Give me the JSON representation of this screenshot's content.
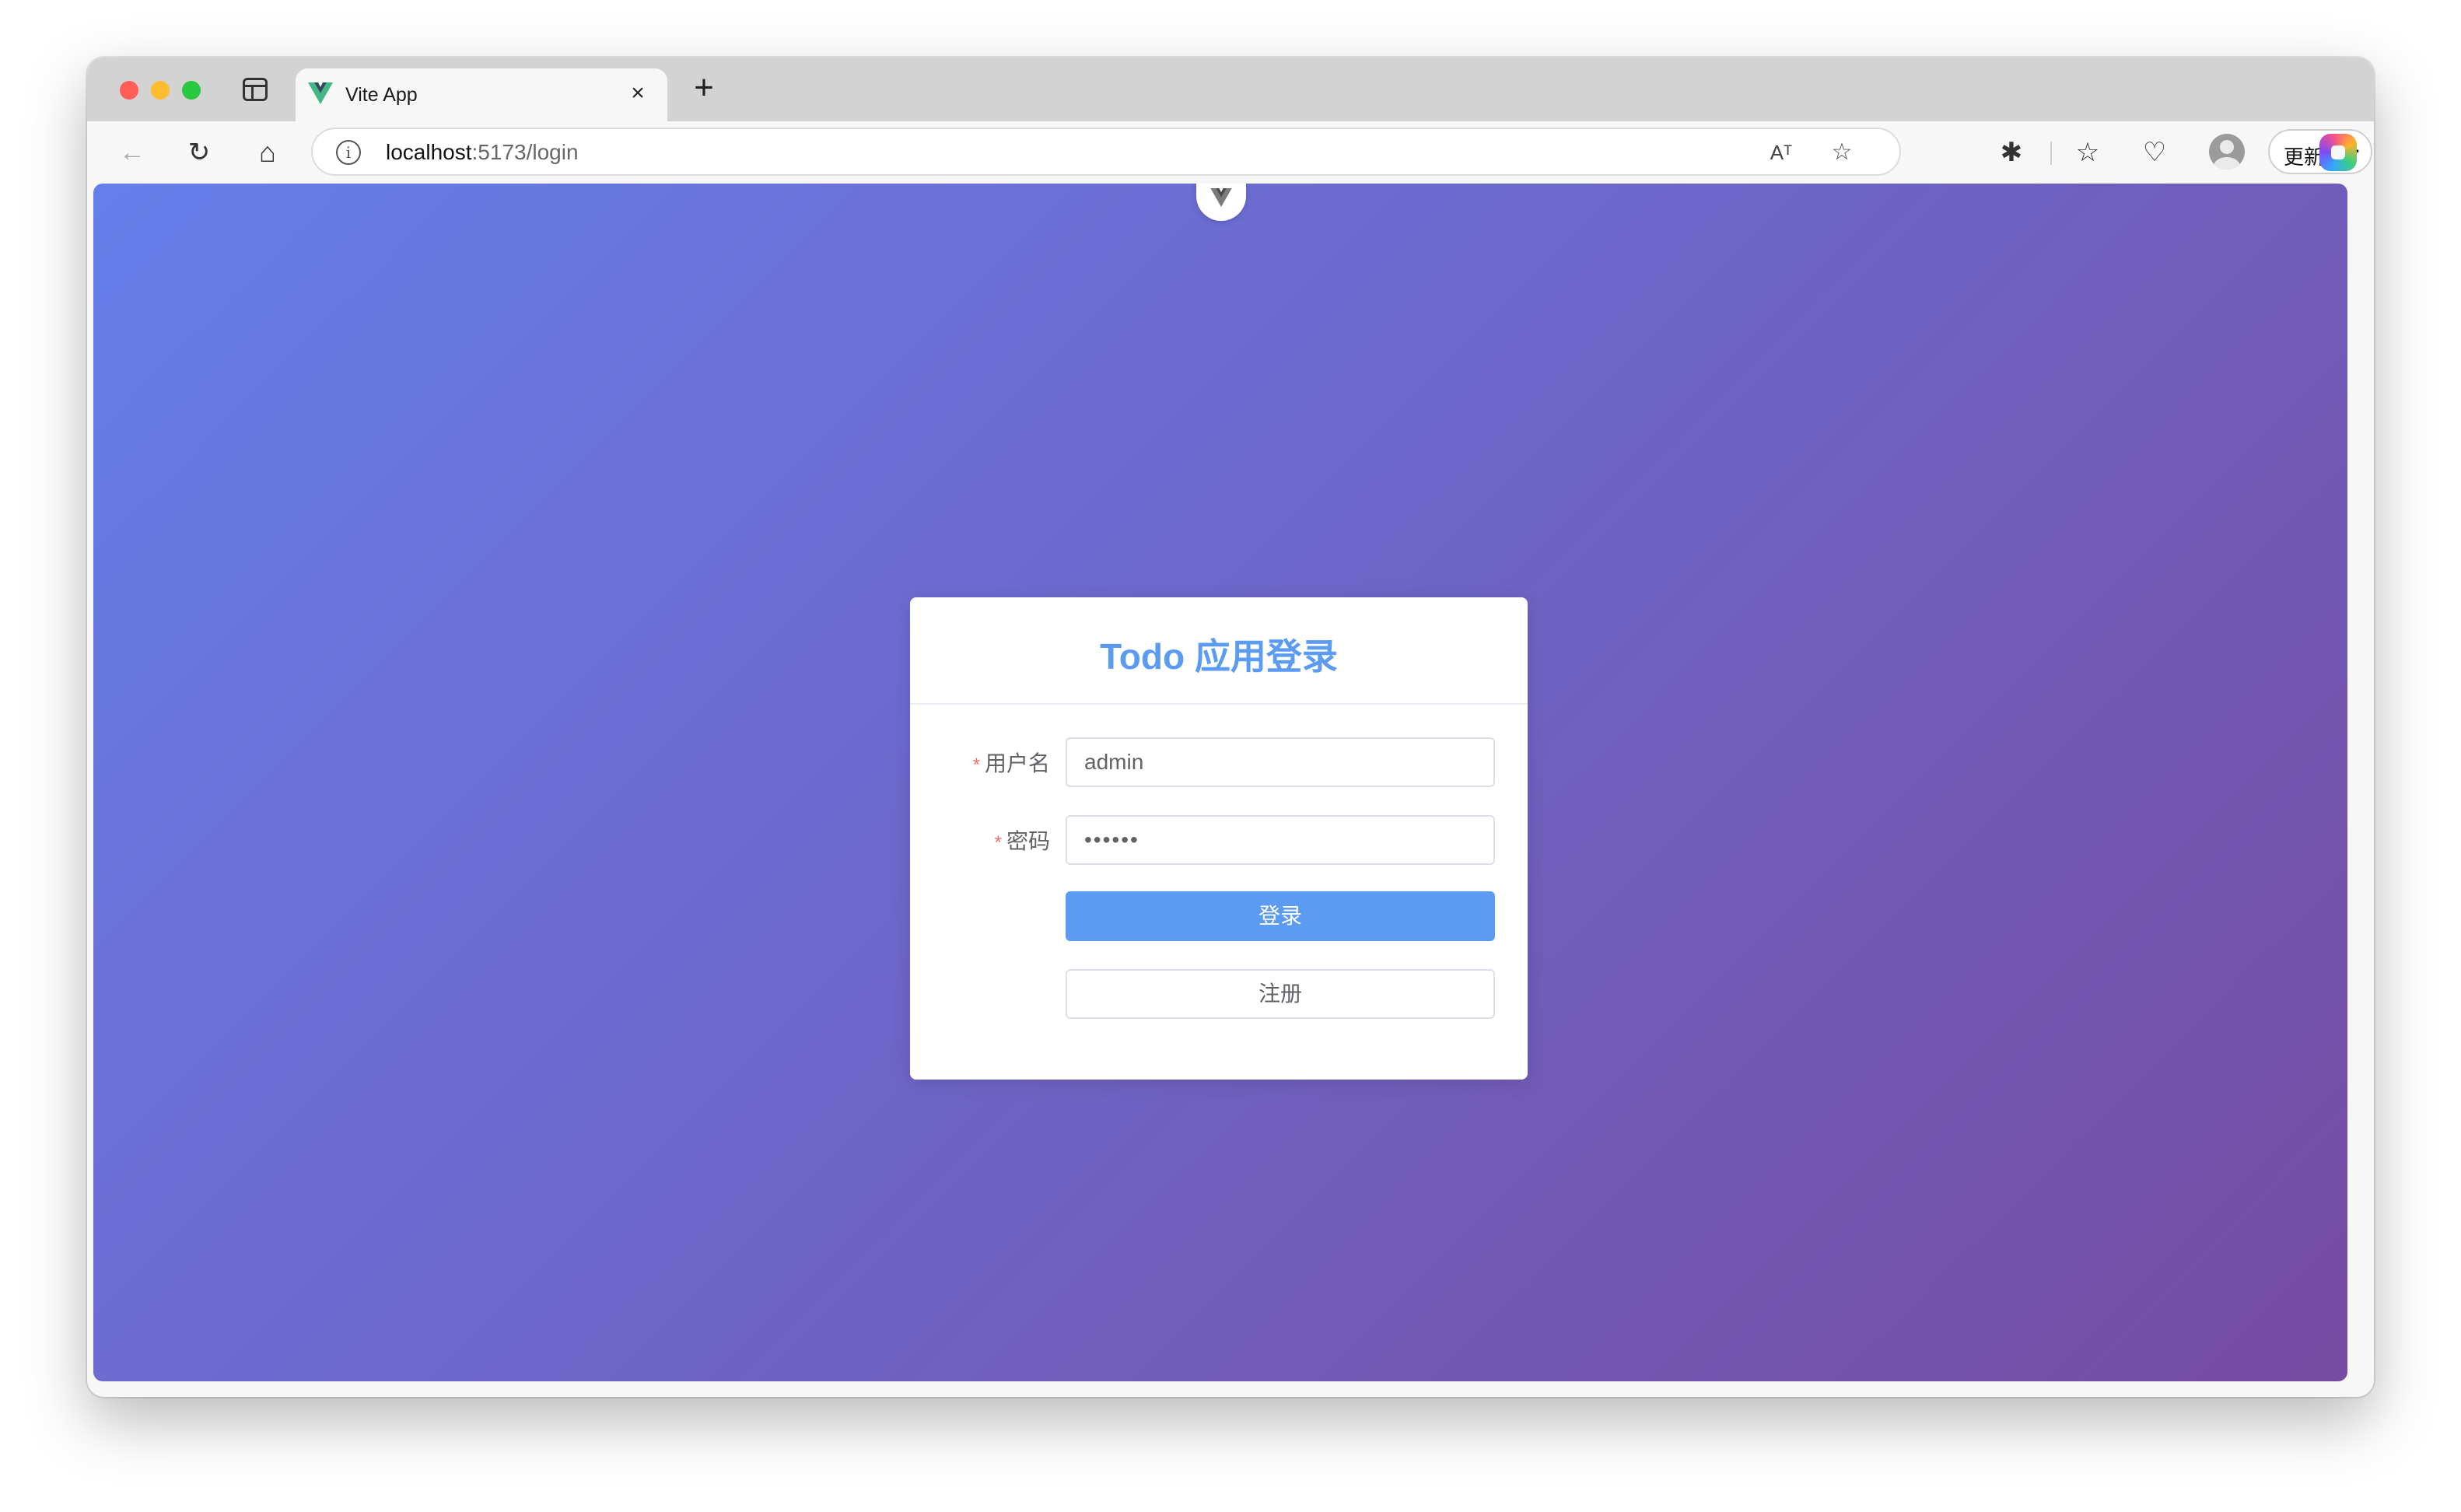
{
  "browser": {
    "tab": {
      "title": "Vite App",
      "close": "×"
    },
    "new_tab": "+",
    "address": {
      "host": "localhost",
      "path": ":5173/login"
    },
    "update_label": "更新",
    "more": "···"
  },
  "icons": {
    "back": "←",
    "reload": "↻",
    "home": "⌂",
    "read_aloud": "Aᵀ",
    "favorite": "☆",
    "extensions": "✱",
    "favorites_list": "☆",
    "health": "♡"
  },
  "login": {
    "title": "Todo 应用登录",
    "username_label": "用户名",
    "username_value": "admin",
    "password_label": "密码",
    "password_value": "••••••",
    "required_mark": "*",
    "login_button": "登录",
    "register_button": "注册"
  },
  "colors": {
    "gradient_start": "#667eea",
    "gradient_end": "#764ba2",
    "primary": "#5b9bf2",
    "required": "#f56c6c"
  }
}
